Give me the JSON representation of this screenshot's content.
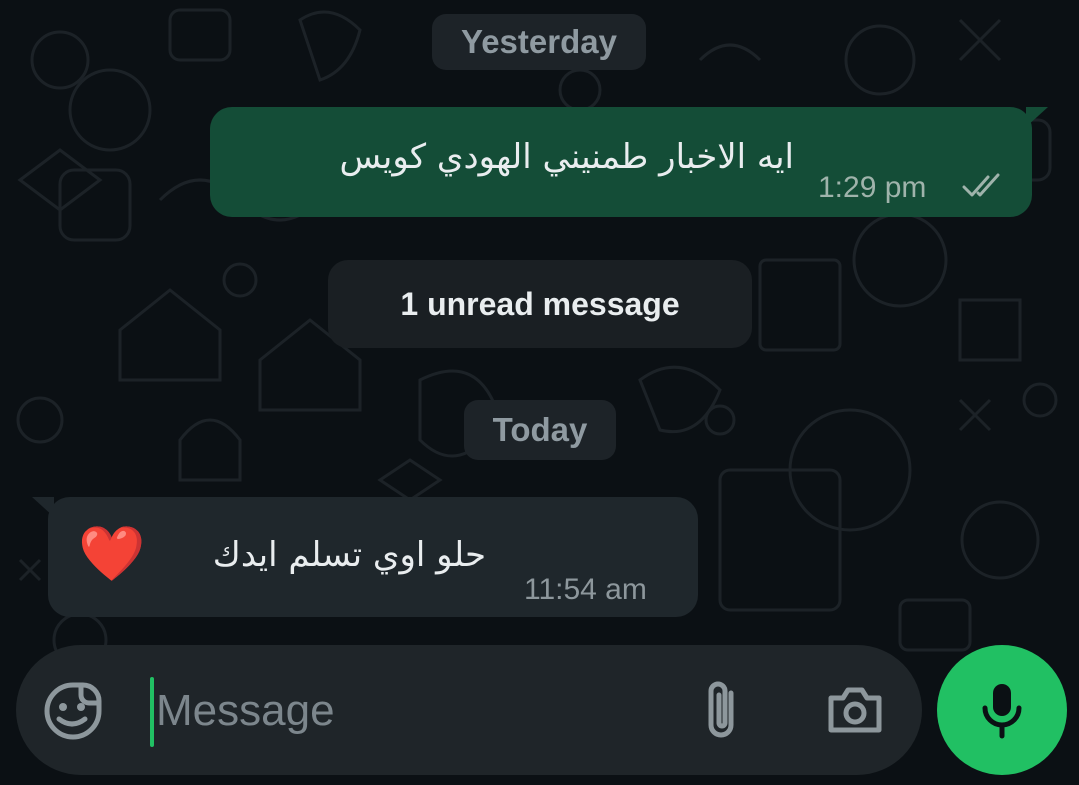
{
  "date_chips": {
    "yesterday": "Yesterday",
    "unread": "1 unread message",
    "today": "Today"
  },
  "messages": [
    {
      "direction": "outgoing",
      "text": "ايه الاخبار طمنيني الهودي كويس",
      "time": "1:29 pm",
      "status": "read",
      "status_icon": "double-check-icon"
    },
    {
      "direction": "incoming",
      "text": "حلو اوي تسلم ايدك",
      "emoji": "❤️",
      "time": "11:54 am"
    }
  ],
  "composer": {
    "placeholder": "Message",
    "icons": [
      "sticker-icon",
      "attach-icon",
      "camera-icon",
      "mic-icon"
    ]
  },
  "colors": {
    "background": "#0b1014",
    "outgoing_bubble": "#144d37",
    "incoming_bubble": "#1f272c",
    "accent": "#21c063"
  }
}
